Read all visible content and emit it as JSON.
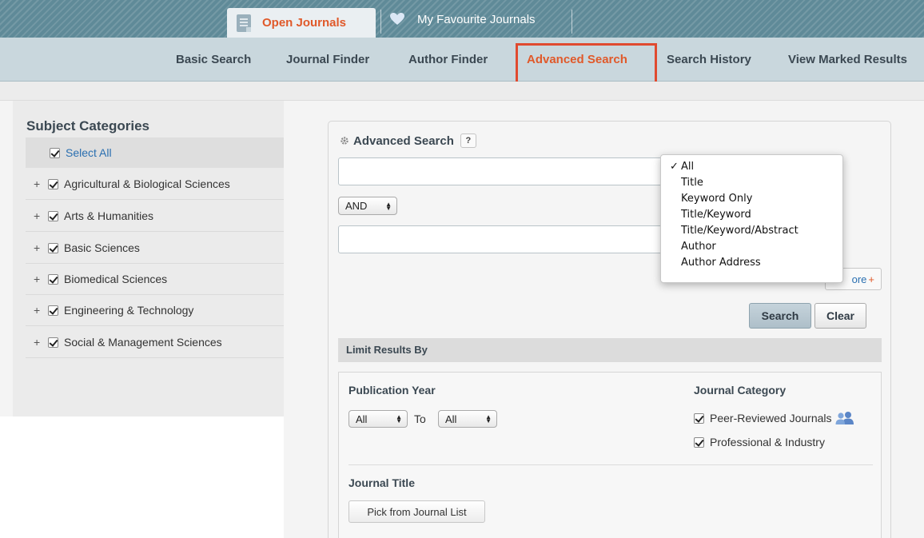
{
  "topbar": {
    "tabs": [
      {
        "label": "Open Journals",
        "icon": "document-icon"
      },
      {
        "label": "My Favourite Journals",
        "icon": "heart-icon"
      }
    ]
  },
  "nav": {
    "items": [
      {
        "label": "Basic Search"
      },
      {
        "label": "Journal Finder"
      },
      {
        "label": "Author Finder"
      },
      {
        "label": "Advanced Search"
      },
      {
        "label": "Search History"
      },
      {
        "label": "View Marked Results"
      }
    ],
    "active_index": 3
  },
  "sidebar": {
    "title": "Subject Categories",
    "select_all": "Select All",
    "categories": [
      {
        "label": "Agricultural & Biological Sciences"
      },
      {
        "label": "Arts & Humanities"
      },
      {
        "label": "Basic Sciences"
      },
      {
        "label": "Biomedical Sciences"
      },
      {
        "label": "Engineering & Technology"
      },
      {
        "label": "Social & Management Sciences"
      }
    ]
  },
  "advanced": {
    "title": "Advanced Search",
    "help": "?",
    "query1": "",
    "operator": "AND",
    "query2": "",
    "more": "ore",
    "more_plus": "+",
    "search_button": "Search",
    "clear_button": "Clear",
    "field_options": [
      "All",
      "Title",
      "Keyword Only",
      "Title/Keyword",
      "Title/Keyword/Abstract",
      "Author",
      "Author Address"
    ],
    "field_selected_check": "✓"
  },
  "limit": {
    "title": "Limit Results By",
    "publication_year": "Publication Year",
    "year_from": "All",
    "to": "To",
    "year_to": "All",
    "journal_category": "Journal Category",
    "categories": [
      "Peer-Reviewed Journals",
      "Professional & Industry"
    ],
    "journal_title": "Journal Title",
    "pick_button": "Pick from Journal List"
  },
  "colors": {
    "accent": "#e0592a",
    "link": "#2a6fb0",
    "highlight_box": "#e04a2f"
  }
}
